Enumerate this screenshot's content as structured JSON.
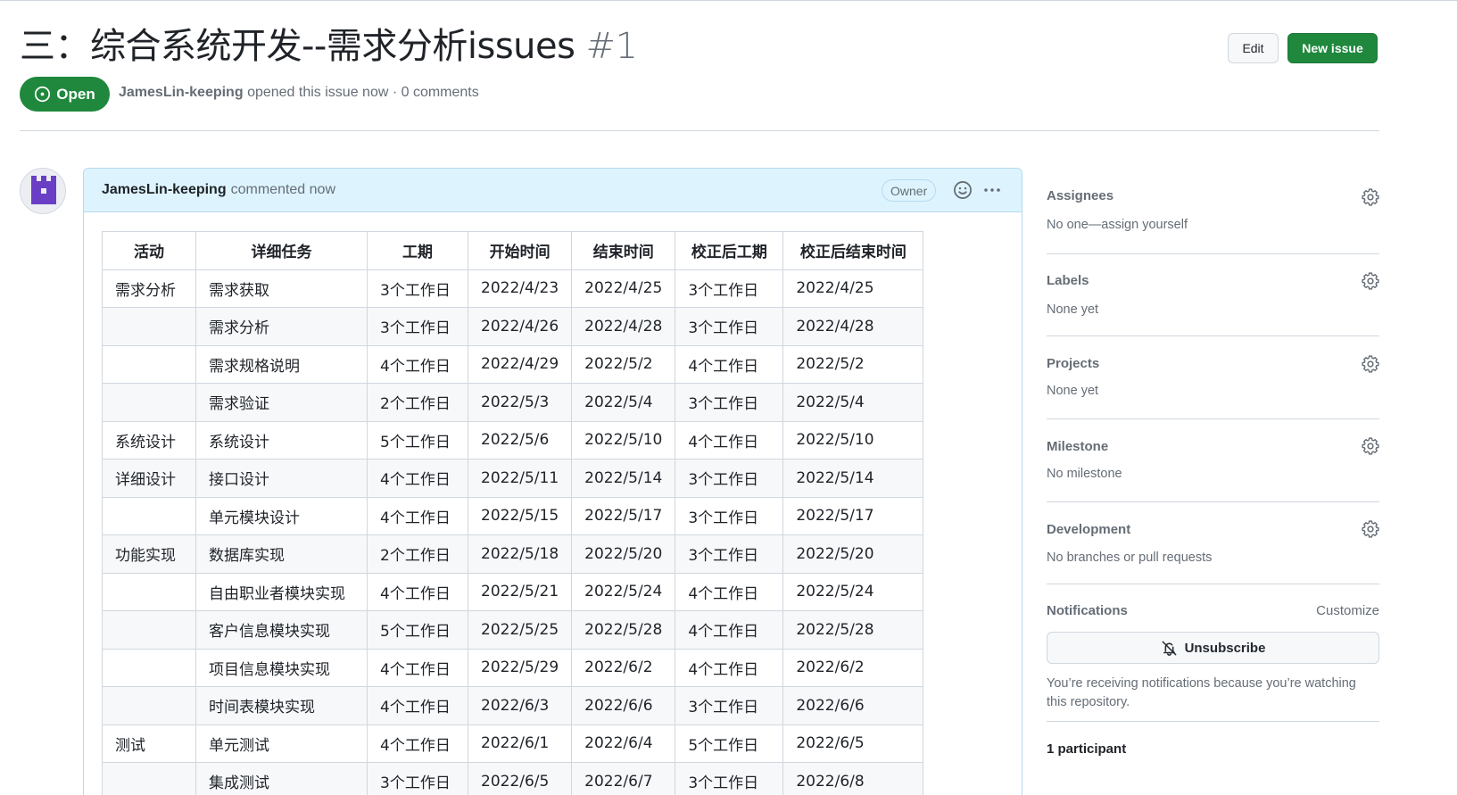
{
  "issue": {
    "title": "三：综合系统开发--需求分析issues",
    "number": "#1",
    "state": "Open",
    "author": "JamesLin-keeping",
    "meta_text": "opened this issue now · 0 comments"
  },
  "header_buttons": {
    "edit": "Edit",
    "new_issue": "New issue"
  },
  "comment": {
    "author": "JamesLin-keeping",
    "action": "commented now",
    "badge": "Owner",
    "table": {
      "headers": [
        "活动",
        "详细任务",
        "工期",
        "开始时间",
        "结束时间",
        "校正后工期",
        "校正后结束时间"
      ],
      "rows": [
        [
          "需求分析",
          "需求获取",
          "3个工作日",
          "2022/4/23",
          "2022/4/25",
          "3个工作日",
          "2022/4/25"
        ],
        [
          "",
          "需求分析",
          "3个工作日",
          "2022/4/26",
          "2022/4/28",
          "3个工作日",
          "2022/4/28"
        ],
        [
          "",
          "需求规格说明",
          "4个工作日",
          "2022/4/29",
          "2022/5/2",
          "4个工作日",
          "2022/5/2"
        ],
        [
          "",
          "需求验证",
          "2个工作日",
          "2022/5/3",
          "2022/5/4",
          "3个工作日",
          "2022/5/4"
        ],
        [
          "系统设计",
          "系统设计",
          "5个工作日",
          "2022/5/6",
          "2022/5/10",
          "4个工作日",
          "2022/5/10"
        ],
        [
          "详细设计",
          "接口设计",
          "4个工作日",
          "2022/5/11",
          "2022/5/14",
          "3个工作日",
          "2022/5/14"
        ],
        [
          "",
          "单元模块设计",
          "4个工作日",
          "2022/5/15",
          "2022/5/17",
          "3个工作日",
          "2022/5/17"
        ],
        [
          "功能实现",
          "数据库实现",
          "2个工作日",
          "2022/5/18",
          "2022/5/20",
          "3个工作日",
          "2022/5/20"
        ],
        [
          "",
          "自由职业者模块实现",
          "4个工作日",
          "2022/5/21",
          "2022/5/24",
          "4个工作日",
          "2022/5/24"
        ],
        [
          "",
          "客户信息模块实现",
          "5个工作日",
          "2022/5/25",
          "2022/5/28",
          "4个工作日",
          "2022/5/28"
        ],
        [
          "",
          "项目信息模块实现",
          "4个工作日",
          "2022/5/29",
          "2022/6/2",
          "4个工作日",
          "2022/6/2"
        ],
        [
          "",
          "时间表模块实现",
          "4个工作日",
          "2022/6/3",
          "2022/6/6",
          "3个工作日",
          "2022/6/6"
        ],
        [
          "测试",
          "单元测试",
          "4个工作日",
          "2022/6/1",
          "2022/6/4",
          "5个工作日",
          "2022/6/5"
        ],
        [
          "",
          "集成测试",
          "3个工作日",
          "2022/6/5",
          "2022/6/7",
          "3个工作日",
          "2022/6/8"
        ]
      ]
    }
  },
  "sidebar": {
    "assignees": {
      "title": "Assignees",
      "value": "No one—assign yourself"
    },
    "labels": {
      "title": "Labels",
      "value": "None yet"
    },
    "projects": {
      "title": "Projects",
      "value": "None yet"
    },
    "milestone": {
      "title": "Milestone",
      "value": "No milestone"
    },
    "development": {
      "title": "Development",
      "value": "No branches or pull requests"
    },
    "notifications": {
      "title": "Notifications",
      "customize": "Customize",
      "unsubscribe": "Unsubscribe",
      "notice": "You’re receiving notifications because you’re watching this repository."
    },
    "participants": {
      "title": "1 participant"
    }
  },
  "colors": {
    "primary_green": "#1f883d",
    "comment_header_bg": "#ddf4ff",
    "border": "#d0d7de",
    "muted_text": "#656d76"
  },
  "icons": {
    "state": "issue-opened-icon",
    "gear": "gear-icon",
    "bell_slash": "bell-slash-icon",
    "smiley": "smiley-icon",
    "kebab": "kebab-horizontal-icon"
  }
}
